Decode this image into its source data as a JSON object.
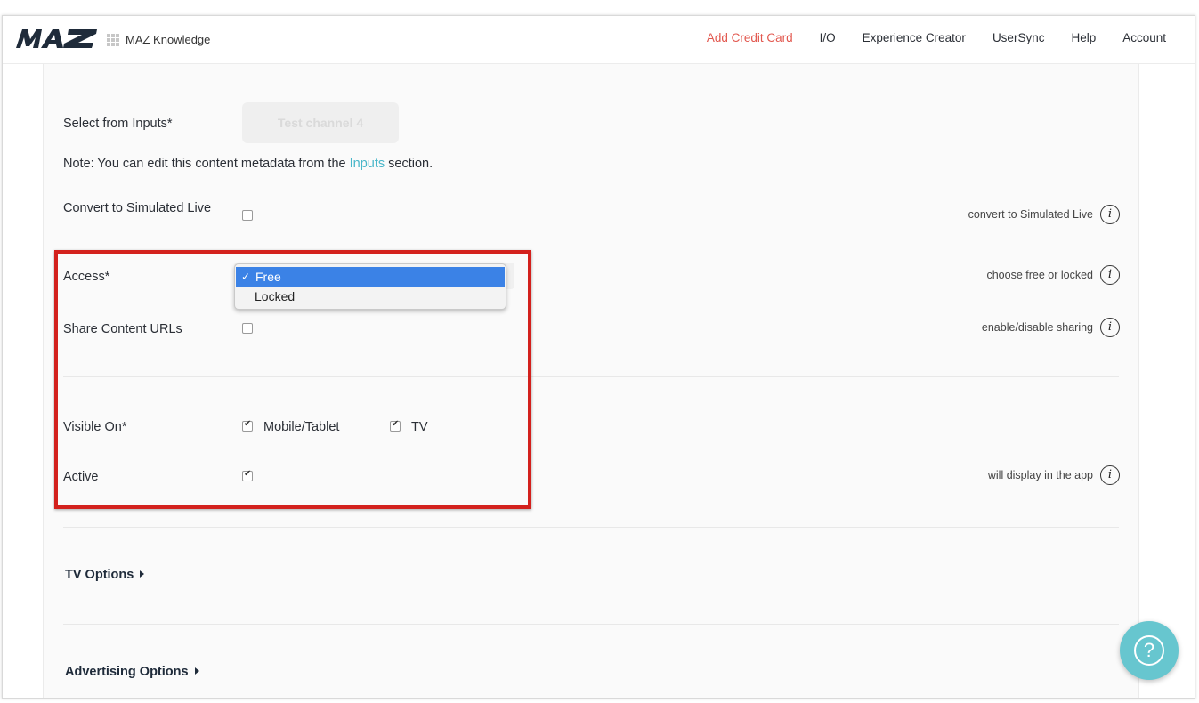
{
  "header": {
    "product": "MAZ Knowledge",
    "nav": [
      "Add Credit Card",
      "I/O",
      "Experience Creator",
      "UserSync",
      "Help",
      "Account"
    ],
    "accent_color": "#e2584f"
  },
  "form": {
    "select_inputs_label": "Select from Inputs*",
    "select_inputs_value": "Test channel 4",
    "note_prefix": "Note: You can edit this content metadata from the ",
    "note_link": "Inputs",
    "note_suffix": " section.",
    "simulated_live_label": "Convert to Simulated Live",
    "simulated_live_hint": "convert to Simulated Live",
    "access_label": "Access*",
    "access_hint": "choose free or locked",
    "access_options": [
      "Free",
      "Locked"
    ],
    "access_selected": "Free",
    "share_label": "Share Content URLs",
    "share_hint": "enable/disable sharing",
    "visible_label": "Visible On*",
    "visible_mobile": "Mobile/Tablet",
    "visible_tv": "TV",
    "active_label": "Active",
    "active_hint": "will display in the app",
    "tv_options": "TV Options",
    "ad_options": "Advertising Options"
  },
  "colors": {
    "link": "#48b6c9",
    "highlight": "#d3211d",
    "fab": "#67c6cf",
    "selected_option": "#3b82e6"
  },
  "icons": {
    "info": "info-icon",
    "help": "question-icon"
  },
  "info_glyph": "i",
  "help_glyph": "?"
}
